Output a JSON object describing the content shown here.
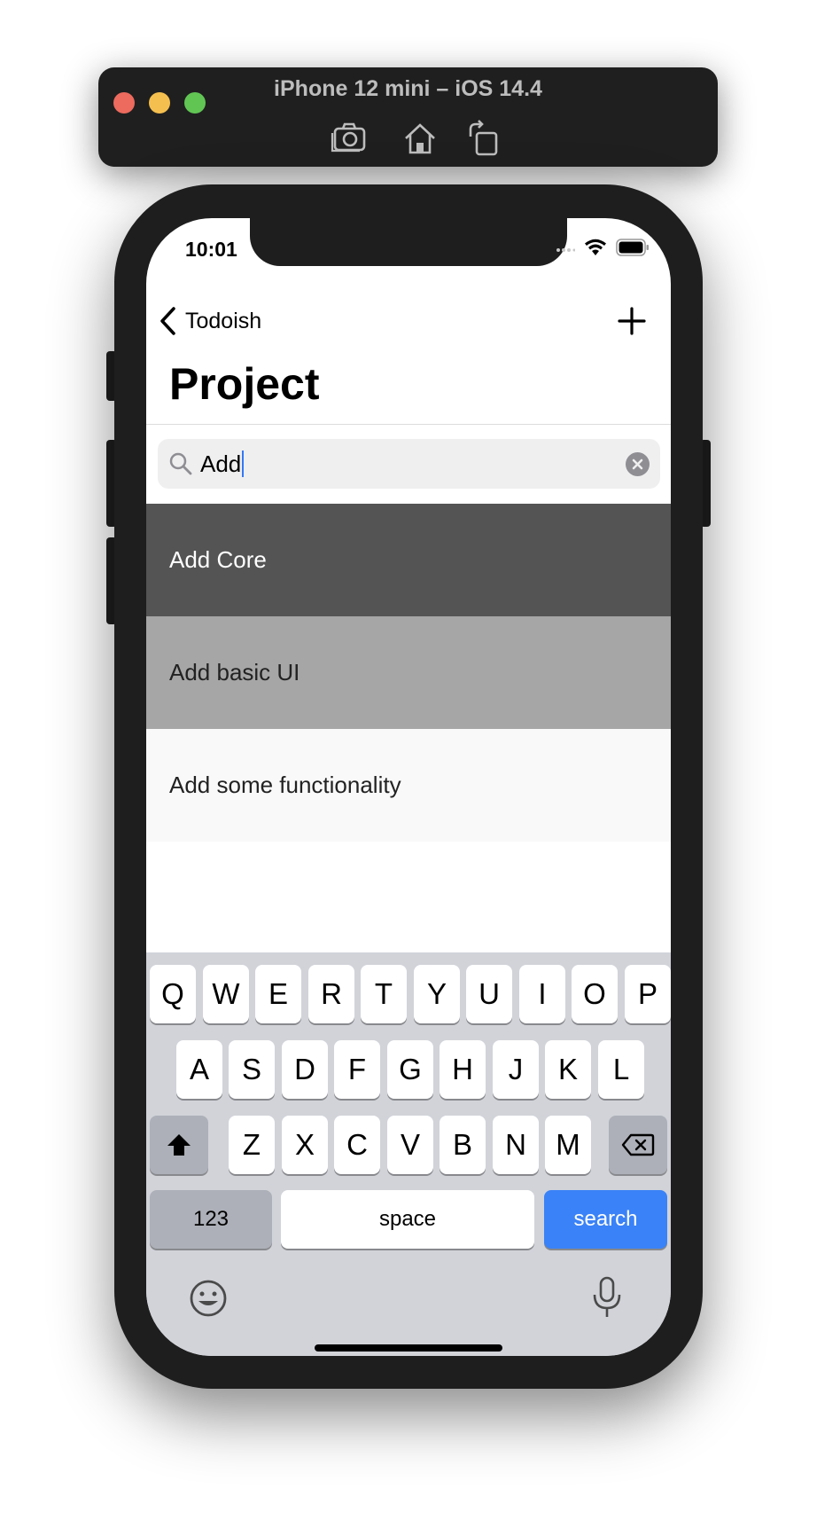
{
  "simulator": {
    "title": "iPhone 12 mini – iOS 14.4",
    "toolbar_icons": [
      "screenshot-icon",
      "home-icon",
      "rotate-icon"
    ]
  },
  "status_bar": {
    "time": "10:01"
  },
  "nav": {
    "back_label": "Todoish",
    "title": "Project",
    "add_icon": "plus-icon"
  },
  "search": {
    "value": "Add",
    "clear_icon": "clear-icon"
  },
  "results": [
    {
      "label": "Add Core",
      "bg": "#545454",
      "color": "#ffffff"
    },
    {
      "label": "Add basic UI",
      "bg": "#a6a6a6",
      "color": "#222222"
    },
    {
      "label": "Add some functionality",
      "bg": "#f9f9f9",
      "color": "#222222"
    }
  ],
  "keyboard": {
    "row1": [
      "Q",
      "W",
      "E",
      "R",
      "T",
      "Y",
      "U",
      "I",
      "O",
      "P"
    ],
    "row2": [
      "A",
      "S",
      "D",
      "F",
      "G",
      "H",
      "J",
      "K",
      "L"
    ],
    "row3": [
      "Z",
      "X",
      "C",
      "V",
      "B",
      "N",
      "M"
    ],
    "numbers_label": "123",
    "space_label": "space",
    "search_label": "search",
    "shift_icon": "shift-icon",
    "delete_icon": "delete-icon",
    "emoji_icon": "emoji-icon",
    "mic_icon": "microphone-icon"
  },
  "colors": {
    "accent": "#3a82f7",
    "keyboard_bg": "#d1d3d9",
    "search_bg": "#efeff0"
  }
}
